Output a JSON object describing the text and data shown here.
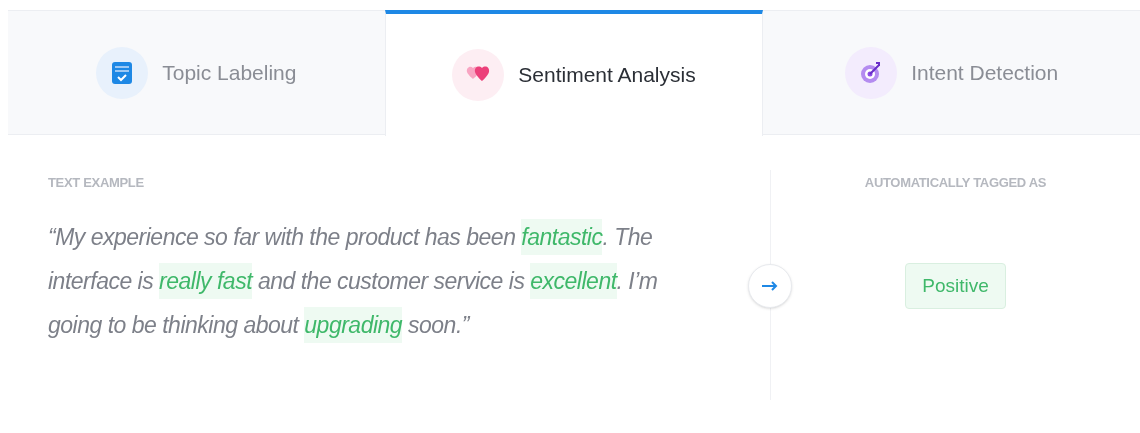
{
  "tabs": [
    {
      "label": "Topic Labeling",
      "kind": "topic",
      "selected": false
    },
    {
      "label": "Sentiment Analysis",
      "kind": "sentiment",
      "selected": true
    },
    {
      "label": "Intent Detection",
      "kind": "intent",
      "selected": false
    }
  ],
  "example": {
    "heading": "TEXT EXAMPLE",
    "segments": [
      {
        "text": "“My experience so far with the product has been ",
        "highlight": false
      },
      {
        "text": "fantastic",
        "highlight": true
      },
      {
        "text": ". The interface is ",
        "highlight": false
      },
      {
        "text": "really fast",
        "highlight": true
      },
      {
        "text": " and the customer service is ",
        "highlight": false
      },
      {
        "text": "excellent",
        "highlight": true
      },
      {
        "text": ". I’m going to be thinking about ",
        "highlight": false
      },
      {
        "text": "upgrading",
        "highlight": true
      },
      {
        "text": " soon.”",
        "highlight": false
      }
    ]
  },
  "result": {
    "heading": "AUTOMATICALLY TAGGED AS",
    "tag": "Positive",
    "color": "#3fb86a"
  }
}
